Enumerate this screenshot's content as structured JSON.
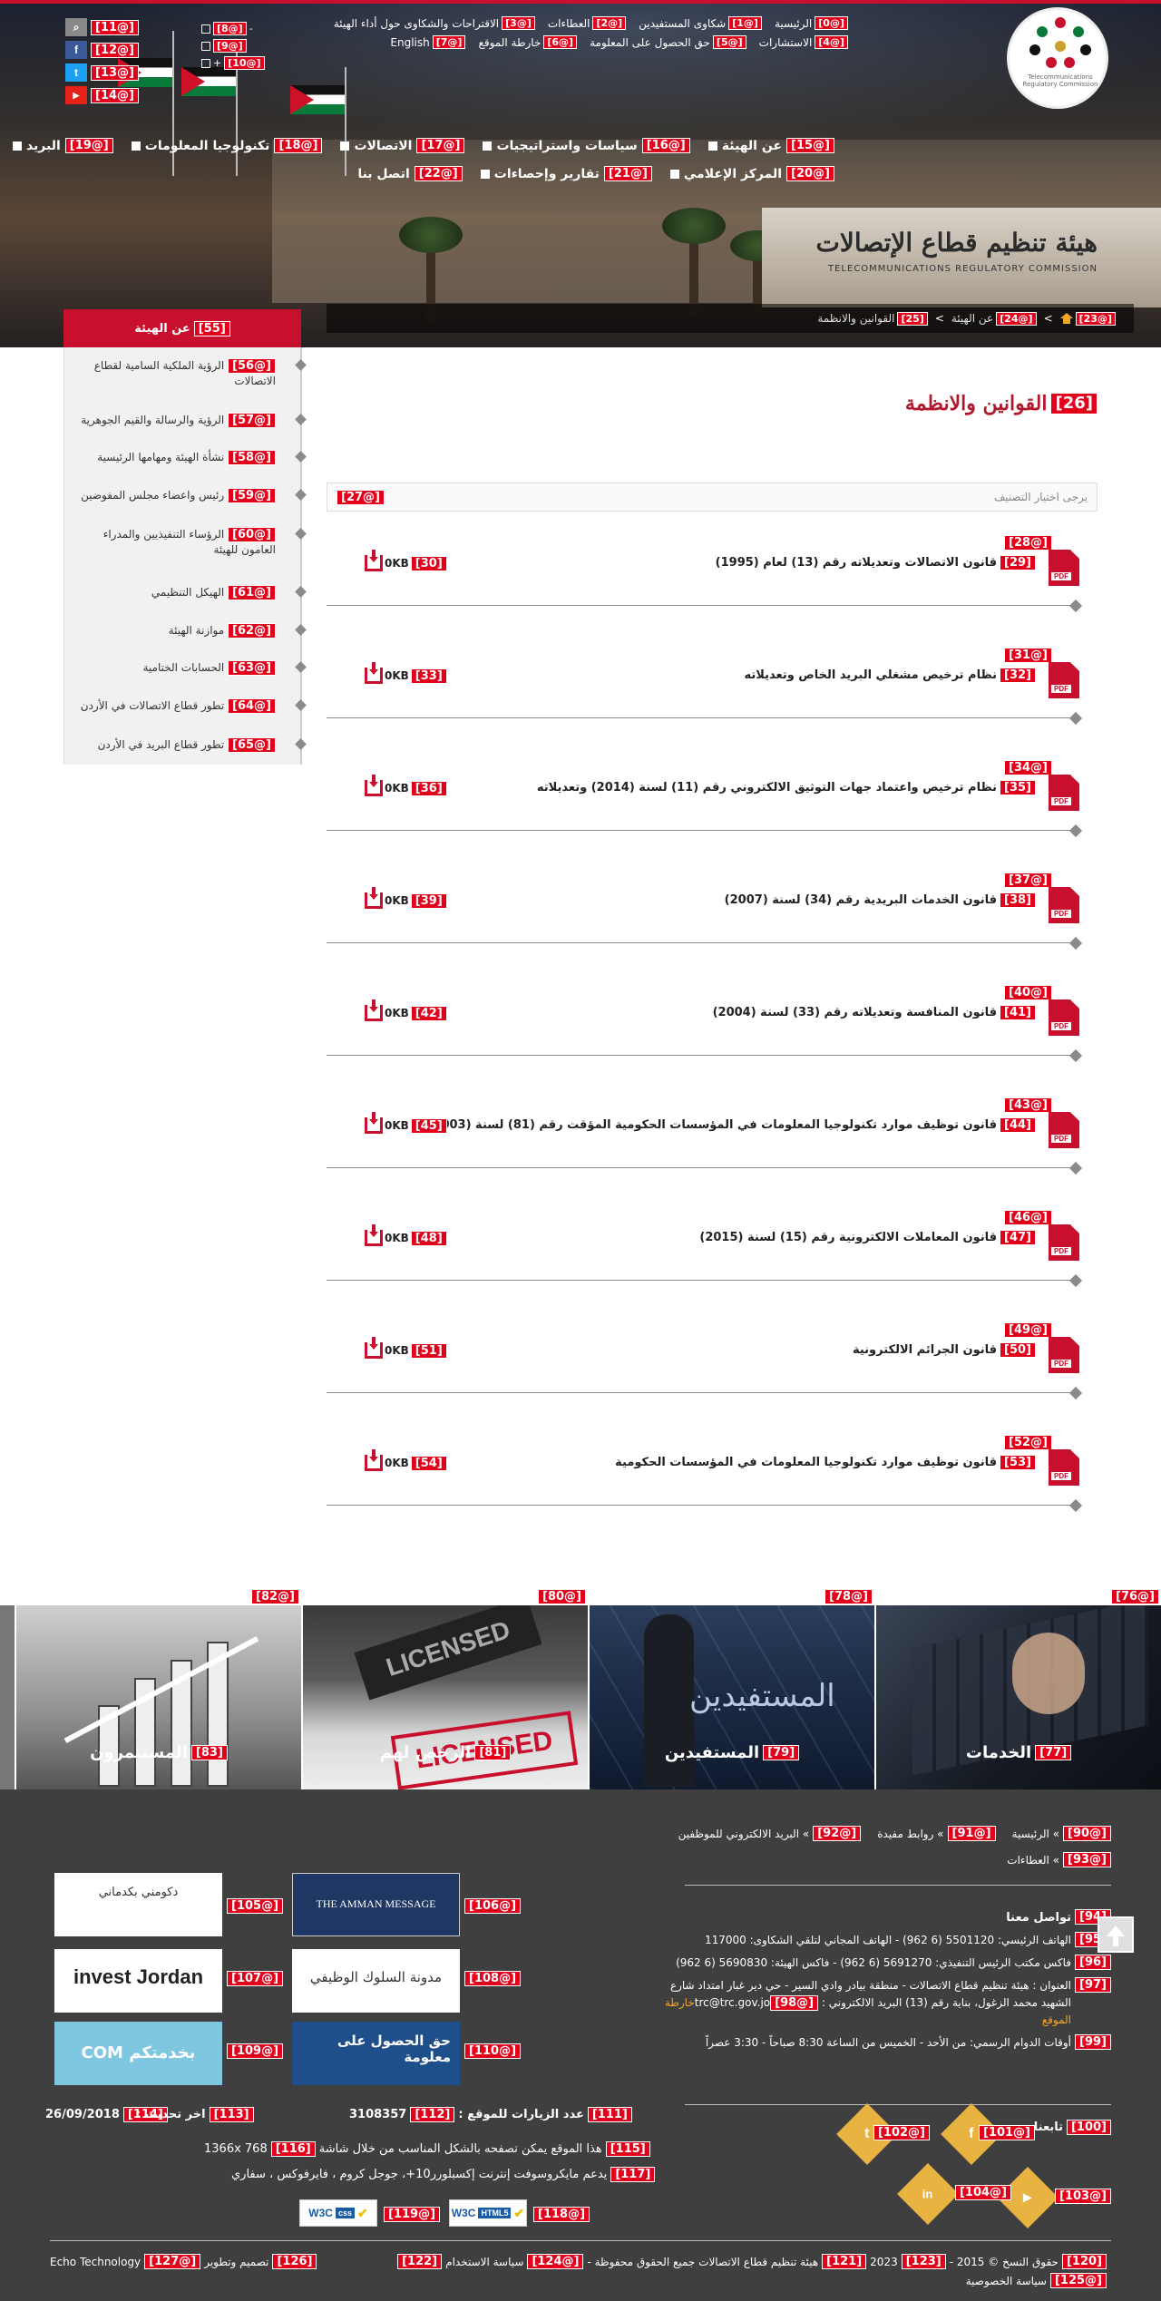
{
  "top_nav": {
    "row1": [
      {
        "tag": "[0@]",
        "label": "الرئيسية"
      },
      {
        "tag": "[1@]",
        "label": "شكاوى المستفيدين"
      },
      {
        "tag": "[2@]",
        "label": "العطاءات"
      },
      {
        "tag": "[3@]",
        "label": "الاقتراحات والشكاوى حول أداء الهيئة"
      }
    ],
    "row2": [
      {
        "tag": "[4@]",
        "label": "الاستشارات"
      },
      {
        "tag": "[5@]",
        "label": "حق الحصول على المعلومة"
      },
      {
        "tag": "[6@]",
        "label": "خارطة الموقع"
      },
      {
        "tag": "[7@]",
        "label": "English"
      }
    ]
  },
  "controls": [
    {
      "tag": "[8@]",
      "label": "-"
    },
    {
      "tag": "[9@]",
      "label": ""
    },
    {
      "tag": "[10@]",
      "label": "+"
    }
  ],
  "social_top": [
    {
      "tag": "[11@]",
      "icon": "search-icon",
      "glyph": "⌕",
      "color": "#888888"
    },
    {
      "tag": "[12@]",
      "icon": "facebook-icon",
      "glyph": "f",
      "color": "#3b5998"
    },
    {
      "tag": "[13@]",
      "icon": "twitter-icon",
      "glyph": "t",
      "color": "#1da1f2"
    },
    {
      "tag": "[14@]",
      "icon": "youtube-icon",
      "glyph": "▶",
      "color": "#e62117"
    }
  ],
  "logo": {
    "ring_text": "Telecommunications Regulatory Commission"
  },
  "main_nav": {
    "row1": [
      {
        "tag": "[15@]",
        "label": "عن الهيئة"
      },
      {
        "tag": "[16@]",
        "label": "سياسات واستراتيجيات"
      },
      {
        "tag": "[17@]",
        "label": "الاتصالات"
      },
      {
        "tag": "[18@]",
        "label": "تكنولوجيا المعلومات"
      },
      {
        "tag": "[19@]",
        "label": "البريد"
      }
    ],
    "row2": [
      {
        "tag": "[20@]",
        "label": "المركز الإعلامي"
      },
      {
        "tag": "[21@]",
        "label": "تقارير وإحصاءات"
      },
      {
        "tag": "[22@]",
        "label": "اتصل بنا"
      }
    ]
  },
  "hero": {
    "sign_ar": "هيئة تنظيم قطاع الإتصالات",
    "sign_en": "TELECOMMUNICATIONS REGULATORY COMMISSION"
  },
  "breadcrumb": [
    {
      "tag": "[23@]",
      "label": ""
    },
    {
      "tag": "[24@]",
      "label": "عن الهيئة"
    },
    {
      "tag": "[25]",
      "label": "القوانين والانظمة"
    }
  ],
  "breadcrumb_sep": ">",
  "sidebar": {
    "title_tag": "[55]",
    "title": "عن الهيئة",
    "items": [
      {
        "tag": "[56@]",
        "label": "الرؤية الملكية السامية لقطاع الاتصالات"
      },
      {
        "tag": "[57@]",
        "label": "الرؤية والرسالة والقيم الجوهرية"
      },
      {
        "tag": "[58@]",
        "label": "نشأة الهيئة ومهامها الرئيسية"
      },
      {
        "tag": "[59@]",
        "label": "رئيس واعضاء مجلس المفوضين"
      },
      {
        "tag": "[60@]",
        "label": "الرؤساء التنفيذيين والمدراء العامون للهيئة"
      },
      {
        "tag": "[61@]",
        "label": "الهيكل التنظيمي"
      },
      {
        "tag": "[62@]",
        "label": "موازنة الهيئة"
      },
      {
        "tag": "[63@]",
        "label": "الحسابات الختامية"
      },
      {
        "tag": "[64@]",
        "label": "تطور قطاع الاتصالات في الأردن"
      },
      {
        "tag": "[65@]",
        "label": "تطور قطاع البريد في الأردن"
      }
    ]
  },
  "page": {
    "title_tag": "[26]",
    "title": "القوانين والانظمة",
    "filter_placeholder": "يرجى اختيار التصنيف",
    "filter_tag": "[27@]"
  },
  "documents": [
    {
      "link_tag": "[28@]",
      "title_tag": "[29]",
      "title": "قانون الاتصالات وتعديلاته رقم (13) لعام (1995)",
      "size": "0KB",
      "dl_tag": "[30]"
    },
    {
      "link_tag": "[31@]",
      "title_tag": "[32]",
      "title": "نظام ترخيص مشغلي البريد الخاص وتعديلاته",
      "size": "0KB",
      "dl_tag": "[33]"
    },
    {
      "link_tag": "[34@]",
      "title_tag": "[35]",
      "title": "نظام ترخيص واعتماد جهات التوثيق الالكتروني رقم (11) لسنة (2014) وتعديلاته",
      "size": "0KB",
      "dl_tag": "[36]"
    },
    {
      "link_tag": "[37@]",
      "title_tag": "[38]",
      "title": "قانون الخدمات البريدية رقم (34) لسنة (2007)",
      "size": "0KB",
      "dl_tag": "[39]"
    },
    {
      "link_tag": "[40@]",
      "title_tag": "[41]",
      "title": "قانون المنافسة وتعديلاته رقم (33) لسنة (2004)",
      "size": "0KB",
      "dl_tag": "[42]"
    },
    {
      "link_tag": "[43@]",
      "title_tag": "[44]",
      "title": "قانون توظيف موارد تكنولوجيا المعلومات في المؤسسات الحكومية المؤقت رقم (81) لسنة (2003)",
      "size": "0KB",
      "dl_tag": "[45]"
    },
    {
      "link_tag": "[46@]",
      "title_tag": "[47]",
      "title": "قانون المعاملات الالكترونية رقم (15) لسنة (2015)",
      "size": "0KB",
      "dl_tag": "[48]"
    },
    {
      "link_tag": "[49@]",
      "title_tag": "[50]",
      "title": "قانون الجرائم الالكترونية",
      "size": "0KB",
      "dl_tag": "[51]"
    },
    {
      "link_tag": "[52@]",
      "title_tag": "[53]",
      "title": "قانون توظيف موارد تكنولوجيا المعلومات في المؤسسات الحكومية",
      "size": "0KB",
      "dl_tag": "[54]"
    }
  ],
  "pdf_label": "PDF",
  "tiles": [
    {
      "link_tag": "[76@]",
      "label_tag": "[77]",
      "label": "الخدمات"
    },
    {
      "link_tag": "[78@]",
      "label_tag": "[79]",
      "label": "المستفيدين"
    },
    {
      "link_tag": "[80@]",
      "label_tag": "[81]",
      "label": "الرخص لهم"
    },
    {
      "link_tag": "[82@]",
      "label_tag": "[83]",
      "label": "المستثمرون"
    }
  ],
  "tile_texts": {
    "licensed": "LICENSED",
    "beneficiaries_ar": "المستفيدين"
  },
  "footer": {
    "links_row1": [
      {
        "tag": "[90@]",
        "label": "» الرئيسية"
      },
      {
        "tag": "[91@]",
        "label": "» روابط مفيدة"
      },
      {
        "tag": "[92@]",
        "label": "» البريد الالكتروني للموظفين"
      }
    ],
    "links_row2": [
      {
        "tag": "[93@]",
        "label": "» العطاءات"
      }
    ],
    "contact_tag": "[94]",
    "contact_title": "تواصل معنا",
    "phone_tag": "[95]",
    "phone": "الهاتف الرئيسي: 5501120 (6 962) - الهاتف المجاني لتلقي الشكاوى: 117000",
    "fax_tag": "[96]",
    "fax": "فاكس مكتب الرئيس التنفيذي: 5691270 (6 962) - فاكس الهيئة: 5690830 (6 962)",
    "address_tag": "[97]",
    "address": "العنوان : هيئة تنظيم قطاع الاتصالات - منطقة بيادر وادي السير - حي دير غبار امتداد شارع الشهيد محمد الزغول، بناية رقم (13) البريد الالكتروني :",
    "email": "trc@trc.gov.jo",
    "email_tag": "[98@]",
    "map_link": "خارطة الموقع",
    "hours_tag": "[99]",
    "hours": "أوقات الدوام الرسمي: من الأحد - الخميس من الساعة 8:30 صباحاً - 3:30 عصراً",
    "follow_tag": "[100]",
    "follow_title": "تابعنا",
    "follow_icons": [
      {
        "tag": "[101@]",
        "icon": "facebook-icon",
        "glyph": "f"
      },
      {
        "tag": "[102@]",
        "icon": "twitter-icon",
        "glyph": "t"
      },
      {
        "tag": "[103@]",
        "icon": "youtube-icon",
        "glyph": "▶"
      },
      {
        "tag": "[104@]",
        "icon": "linkedin-icon",
        "glyph": "in"
      }
    ],
    "banners": [
      {
        "tag": "[105@]",
        "name": "dakmni-banner",
        "text": "دكومني بكدماني",
        "bg": "#ffffff",
        "fg": "#333333"
      },
      {
        "tag": "[106@]",
        "name": "amman-message-banner",
        "text": "THE AMMAN MESSAGE",
        "bg": "#1f3763",
        "fg": "#ffffff"
      },
      {
        "tag": "[107@]",
        "name": "invest-jordan-banner",
        "text": "invest Jordan",
        "bg": "#ffffff",
        "fg": "#222222"
      },
      {
        "tag": "[108@]",
        "name": "code-of-conduct-banner",
        "text": "مدونة السلوك الوظيفي",
        "bg": "#ffffff",
        "fg": "#333333"
      },
      {
        "tag": "[109@]",
        "name": "bekhedmetkom-banner",
        "text": "بخدمتكم COM",
        "bg": "#7fc6e0",
        "fg": "#ffffff"
      },
      {
        "tag": "[110@]",
        "name": "right-to-information-banner",
        "text": "حق الحصول على معلومة",
        "bg": "#1f4f8a",
        "fg": "#ffffff"
      }
    ],
    "visits_tag": "[111]",
    "visits_label": "عدد الزيارات للموقع :",
    "visits_value_tag": "[112]",
    "visits_value": "3108357",
    "updated_tag": "[113]",
    "updated_label": "اخر تحديث :",
    "updated_value_tag": "[114]",
    "updated_value": "26/09/2018",
    "resolution_tag": "[115]",
    "resolution": "هذا الموقع يمكن تصفحه بالشكل المناسب من خلال شاشة",
    "resolution_value_tag": "[116]",
    "resolution_value": "1366x 768",
    "browsers_tag": "[117]",
    "browsers": "يدعم مايكروسوفت إنترنت إكسبلورر10+، جوجل كروم ، فايرفوكس ، سفاري",
    "w3c": [
      {
        "tag": "[118@]",
        "label": "W3C",
        "kind": "HTML5"
      },
      {
        "tag": "[119@]",
        "label": "W3C",
        "kind": "css"
      }
    ],
    "copyright_tag": "[120]",
    "copyright": "حقوق النسخ © 2015 -",
    "year_tag": "[123]",
    "year": "2023",
    "rights_tag": "[121]",
    "rights": "هيئة تنظيم قطاع الاتصالات جميع الحقوق محفوظة -",
    "terms_tag": "[124@]",
    "terms": "سياسة الاستخدام",
    "privacy_sep_tag": "[122]",
    "privacy_tag": "[125@]",
    "privacy": "سياسة الخصوصية",
    "design_tag": "[126]",
    "design": "تصميم وتطوير",
    "designer_tag": "[127@]",
    "designer": "Echo Technology"
  }
}
